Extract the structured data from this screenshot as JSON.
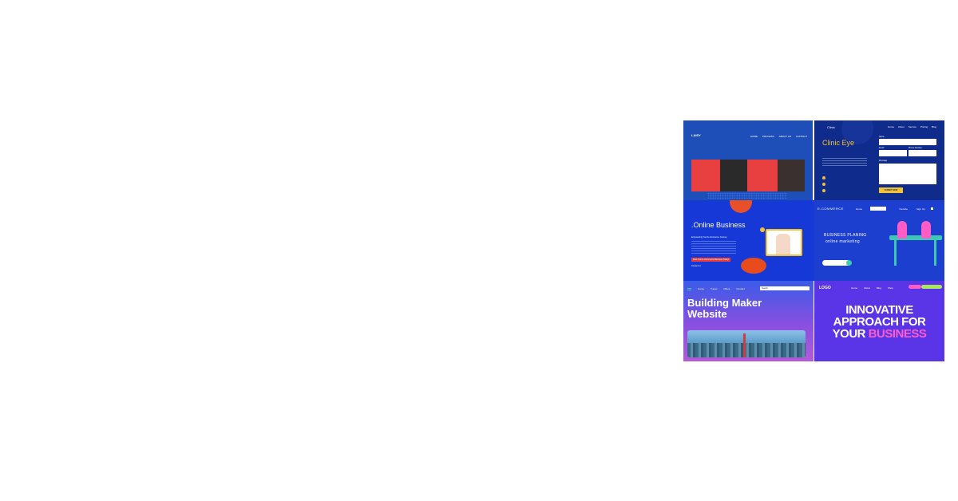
{
  "tiles": {
    "t1": {
      "logo": "LAISY",
      "nav": [
        "HOME",
        "PROCESS",
        "ABOUT US",
        "CONTACT"
      ]
    },
    "t2": {
      "logo": "Clinic",
      "title": "Clinic Eye",
      "nav": [
        "Home",
        "About",
        "Service",
        "Pricing",
        "Blog"
      ],
      "fields": [
        "Name",
        "Email",
        "Phone Number",
        "Message"
      ],
      "submit": "SUBMIT NOW"
    },
    "t3": {
      "title": ".Online Business",
      "subtitle": "Empowering Your E-Commerce Journey",
      "cta": "Start Your E-Commerce Business Today!",
      "contact": "Contact us"
    },
    "t4": {
      "brand": "E-COMMERCE",
      "nav": [
        "Home",
        "Youtube",
        "Sign Up"
      ],
      "heading1": "BUSINESS PLANING",
      "heading2": "online marketing"
    },
    "t5": {
      "nav": [
        "Home",
        "Travel",
        "Offers",
        "Contact"
      ],
      "search": "Search",
      "title_line1": "Building Maker",
      "title_line2": "Website"
    },
    "t6": {
      "logo": "LOGO",
      "nav": [
        "Home",
        "About",
        "Blog",
        "Shop"
      ],
      "headline_line1": "INNOVATIVE",
      "headline_line2": "APPROACH FOR",
      "headline_line3a": "YOUR",
      "headline_line3b": "BUSINESS"
    }
  },
  "colors": {
    "accent_yellow": "#f2c230",
    "accent_pink": "#ff5cc8",
    "accent_red": "#e84040"
  }
}
